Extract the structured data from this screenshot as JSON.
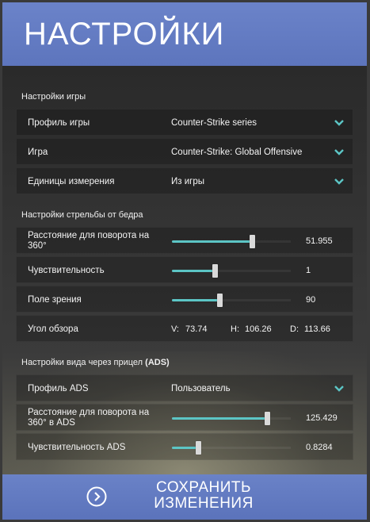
{
  "header": {
    "title": "НАСТРОЙКИ"
  },
  "game_settings": {
    "title": "Настройки игры",
    "rows": [
      {
        "label": "Профиль игры",
        "value": "Counter-Strike series"
      },
      {
        "label": "Игра",
        "value": "Counter-Strike: Global Offensive"
      },
      {
        "label": "Единицы измерения",
        "value": "Из игры"
      }
    ]
  },
  "hip_settings": {
    "title": "Настройки стрельбы от бедра",
    "rotation": {
      "label": "Расстояние для поворота на 360°",
      "value": "51.955",
      "fill": 0.67
    },
    "sensitivity": {
      "label": "Чувствительность",
      "value": "1",
      "fill": 0.36
    },
    "fov": {
      "label": "Поле зрения",
      "value": "90",
      "fill": 0.4
    },
    "view_angle": {
      "label": "Угол обзора",
      "v_label": "V:",
      "v_value": "73.74",
      "h_label": "H:",
      "h_value": "106.26",
      "d_label": "D:",
      "d_value": "113.66"
    }
  },
  "ads_settings": {
    "title_main": "Настройки вида через прицел",
    "title_bold": "(ADS)",
    "profile": {
      "label": "Профиль ADS",
      "value": "Пользователь"
    },
    "rotation": {
      "label": "Расстояние для поворота на 360° в ADS",
      "value": "125.429",
      "fill": 0.8
    },
    "sensitivity": {
      "label": "Чувствительность ADS",
      "value": "0.8284",
      "fill": 0.22
    }
  },
  "footer": {
    "save_label": "СОХРАНИТЬ ИЗМЕНЕНИЯ"
  },
  "colors": {
    "accent": "#5cc5c5",
    "header": "#6b83c9",
    "panel": "#343434"
  },
  "icons": {
    "dropdown": "chevron-down-icon",
    "save": "chevron-right-circle-icon"
  }
}
